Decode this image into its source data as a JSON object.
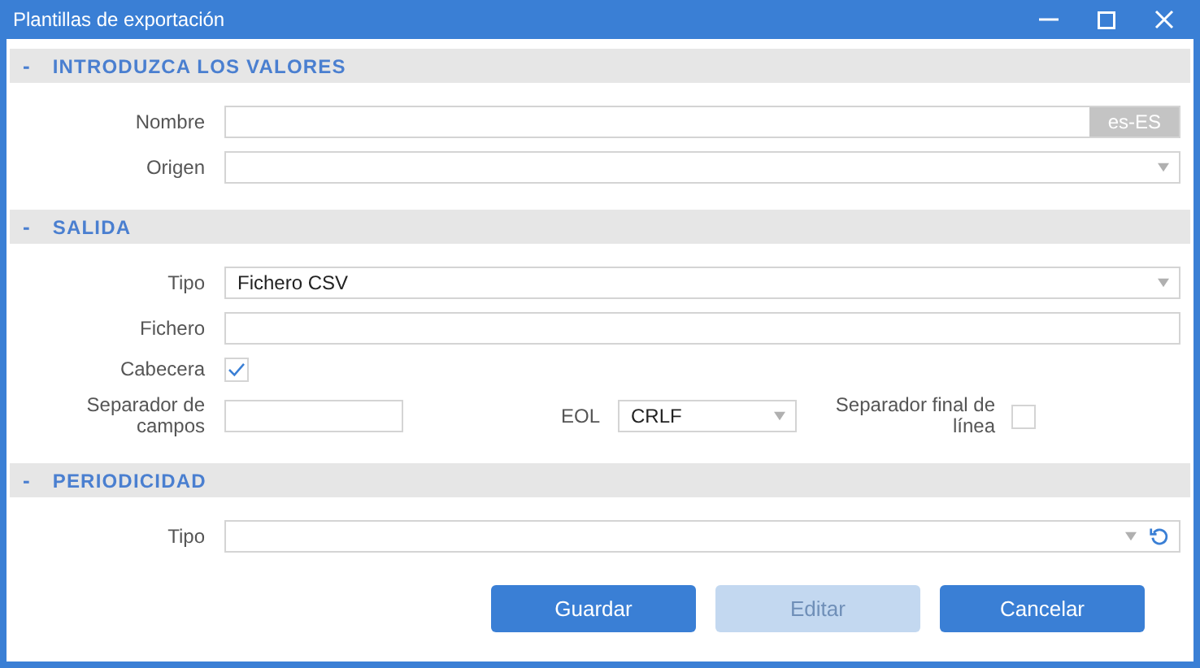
{
  "window": {
    "title": "Plantillas de exportación"
  },
  "sections": [
    {
      "toggle": "-",
      "title": "INTRODUZCA LOS VALORES",
      "expanded": true,
      "fields": [
        {
          "kind": "text",
          "label": "Nombre",
          "addon": "es-ES"
        },
        {
          "kind": "select",
          "label": "Origen"
        }
      ]
    },
    {
      "toggle": "-",
      "title": "SALIDA",
      "expanded": true,
      "fields": [
        {
          "kind": "select",
          "label": "Tipo",
          "value": "Fichero CSV"
        },
        {
          "kind": "text",
          "label": "Fichero"
        },
        {
          "kind": "checkbox",
          "label": "Cabecera",
          "checked": true
        },
        {
          "kind": "row",
          "items": [
            {
              "kind": "text",
              "label": "Separador de campos"
            },
            {
              "kind": "select",
              "label": "EOL",
              "value": "CRLF"
            },
            {
              "kind": "checkbox",
              "label": "Separador final de línea",
              "checked": false
            }
          ]
        }
      ]
    },
    {
      "toggle": "-",
      "title": "PERIODICIDAD",
      "expanded": true,
      "fields": [
        {
          "kind": "select",
          "label": "Tipo",
          "reset": true
        }
      ]
    }
  ],
  "buttons": [
    {
      "label": "Guardar",
      "disabled": false
    },
    {
      "label": "Editar",
      "disabled": true
    },
    {
      "label": "Cancelar",
      "disabled": false
    }
  ]
}
